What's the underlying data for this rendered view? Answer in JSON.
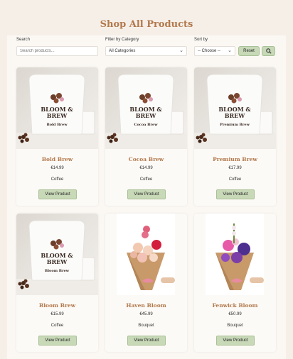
{
  "page_title": "Shop All Products",
  "filters": {
    "search_label": "Search",
    "search_placeholder": "Search products...",
    "category_label": "Filter by Category",
    "category_value": "All Categories",
    "sort_label": "Sort by",
    "sort_value": "-- Choose --",
    "reset_label": "Reset",
    "search_icon": "search-icon"
  },
  "products": [
    {
      "name": "Bold Brew",
      "price": "€14.99",
      "category": "Coffee",
      "button": "View Product",
      "type": "coffee",
      "bag_text": "Bold Brew"
    },
    {
      "name": "Cocoa Brew",
      "price": "€14.99",
      "category": "Coffee",
      "button": "View Product",
      "type": "coffee",
      "bag_text": "Cocoa Brew"
    },
    {
      "name": "Premium Brew",
      "price": "€17.99",
      "category": "Coffee",
      "button": "View Product",
      "type": "coffee",
      "bag_text": "Premium Brew"
    },
    {
      "name": "Bloom Brew",
      "price": "€15.99",
      "category": "Coffee",
      "button": "View Product",
      "type": "coffee",
      "bag_text": "Bloom Brew"
    },
    {
      "name": "Haven Bloom",
      "price": "€45.99",
      "category": "Bouquet",
      "button": "View Product",
      "type": "bouquet"
    },
    {
      "name": "Fenwick Bloom",
      "price": "€50.99",
      "category": "Bouquet",
      "button": "View Product",
      "type": "bouquet"
    }
  ],
  "brand_logo_text": "BLOOM & BREW",
  "colors": {
    "accent": "#b2794d",
    "button": "#c8d9b8",
    "background": "#f6efe8"
  }
}
